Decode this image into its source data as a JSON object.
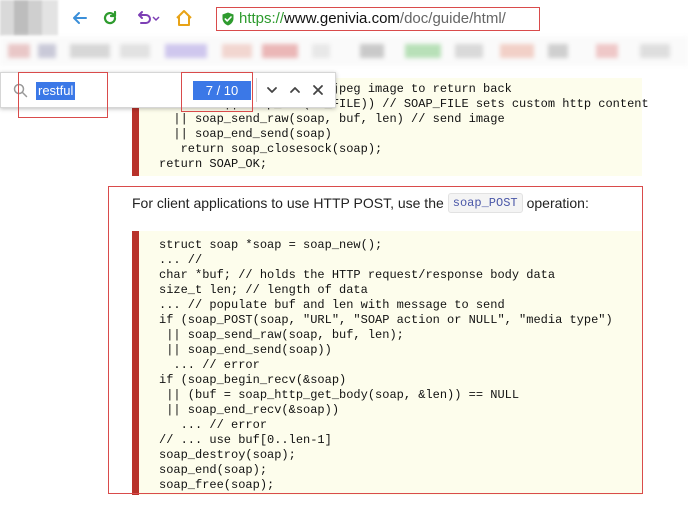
{
  "browser": {
    "url_proto": "https://",
    "url_host": "www.genivia.com",
    "url_path": "/doc/guide/html/"
  },
  "find": {
    "query": "restful",
    "count": "7 / 10"
  },
  "code_top": [
    "        /* ... */; // a jpeg image to return back",
    "         || soap_...(AP_FILE)) // SOAP_FILE sets custom http content",
    "  || soap_send_raw(soap, buf, len) // send image",
    "  || soap_end_send(soap)",
    "   return soap_closesock(soap);",
    "return SOAP_OK;"
  ],
  "paragraph": {
    "before": "For client applications to use HTTP POST, use the",
    "code": "soap_POST",
    "after": "operation:"
  },
  "code_main": [
    "struct soap *soap = soap_new();",
    "... //",
    "char *buf; // holds the HTTP request/response body data",
    "size_t len; // length of data",
    "... // populate buf and len with message to send",
    "if (soap_POST(soap, \"URL\", \"SOAP action or NULL\", \"media type\")",
    " || soap_send_raw(soap, buf, len);",
    " || soap_end_send(soap))",
    "  ... // error",
    "if (soap_begin_recv(&soap)",
    " || (buf = soap_http_get_body(soap, &len)) == NULL",
    " || soap_end_recv(&soap))",
    "   ... // error",
    "// ... use buf[0..len-1]",
    "soap_destroy(soap);",
    "soap_end(soap);",
    "soap_free(soap);"
  ],
  "colors": {
    "accent_red": "#d94b4b",
    "find_highlight": "#3b78e7",
    "code_bg": "#fdfdec",
    "code_border": "#b8322a"
  },
  "icons": [
    "back-arrow-icon",
    "reload-icon",
    "undo-icon",
    "home-icon",
    "lock-icon",
    "search-icon",
    "chevron-down-icon",
    "chevron-up-icon",
    "close-icon"
  ]
}
